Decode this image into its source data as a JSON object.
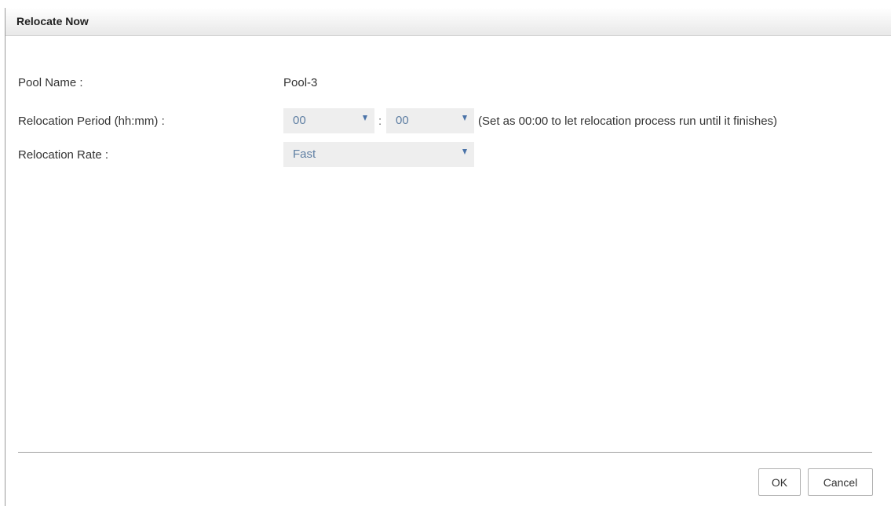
{
  "dialog": {
    "title": "Relocate Now"
  },
  "form": {
    "pool_name_label": "Pool Name :",
    "pool_name_value": "Pool-3",
    "period_label": "Relocation Period (hh:mm) :",
    "period_hours": "00",
    "period_separator": ":",
    "period_minutes": "00",
    "period_hint": "(Set as 00:00 to let relocation process run until it finishes)",
    "rate_label": "Relocation Rate :",
    "rate_value": "Fast"
  },
  "buttons": {
    "ok_label": "OK",
    "cancel_label": "Cancel"
  },
  "icons": {
    "dropdown": "chevron-down-icon"
  },
  "colors": {
    "select_text": "#5f7fa3",
    "select_bg": "#eeeeee",
    "arrow": "#4a73a8"
  }
}
